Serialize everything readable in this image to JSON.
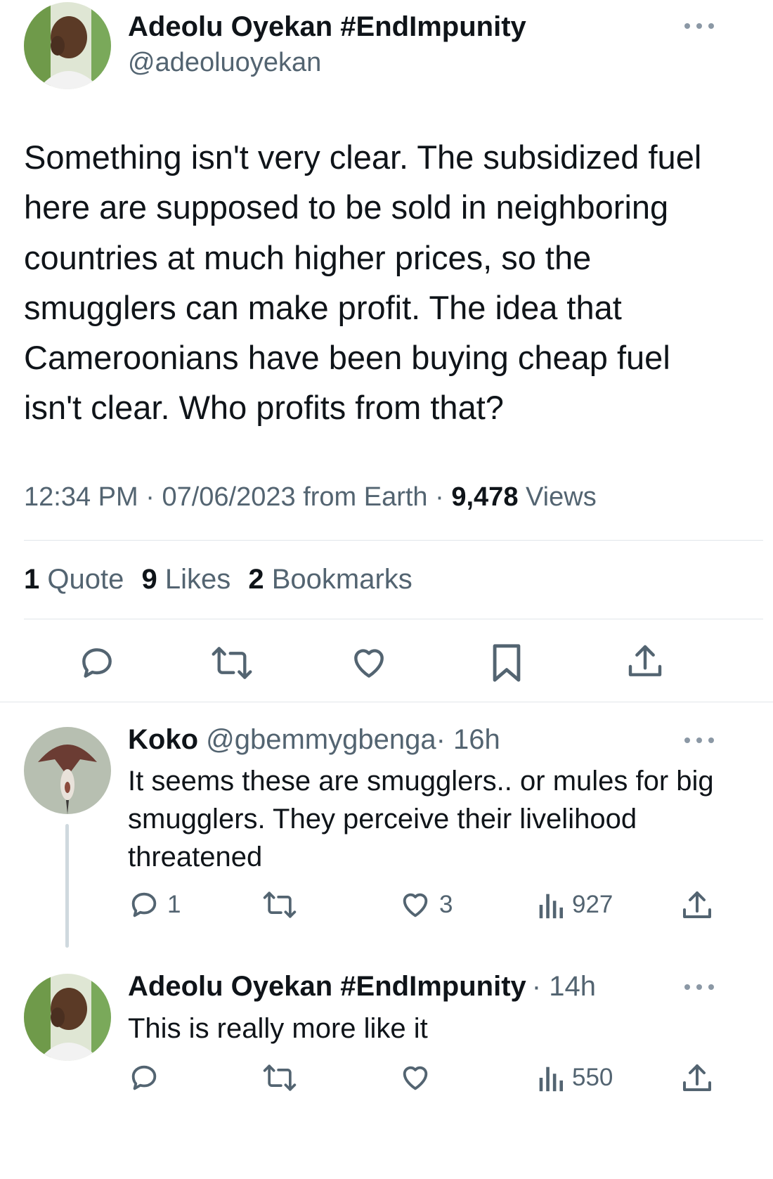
{
  "tweet": {
    "author_name": "Adeolu Oyekan #EndImpunity",
    "author_handle": "@adeoluoyekan",
    "text": "Something isn't very clear. The subsidized fuel here are supposed to be sold in neighboring countries at much higher prices, so the smugglers can make profit. The idea that Cameroonians have been buying cheap fuel isn't clear. Who profits from that?",
    "time": "12:34 PM",
    "dot1": "·",
    "date": "07/06/2023",
    "source": "from Earth",
    "dot2": "·",
    "views_count": "9,478",
    "views_label": "Views",
    "stats": {
      "quotes_count": "1",
      "quotes_label": "Quote",
      "likes_count": "9",
      "likes_label": "Likes",
      "bookmarks_count": "2",
      "bookmarks_label": "Bookmarks"
    },
    "actions": [
      "reply-icon",
      "retweet-icon",
      "like-icon",
      "bookmark-icon",
      "share-icon"
    ]
  },
  "replies": [
    {
      "name": "Koko",
      "handle": "@gbemmygbenga",
      "separator": "·",
      "time": "16h",
      "text": "It seems these are smugglers.. or mules for big smugglers. They perceive their livelihood threatened",
      "reply_count": "1",
      "retweet_count": "",
      "like_count": "3",
      "views_count": "927"
    },
    {
      "name": "Adeolu Oyekan #EndImpunity",
      "handle": "",
      "separator": "·",
      "time": "14h",
      "text": "This is really more like it",
      "reply_count": "",
      "retweet_count": "",
      "like_count": "",
      "views_count": "550"
    }
  ],
  "colors": {
    "text": "#0f1419",
    "secondary": "#536471",
    "divider": "#e1e6ea",
    "thread_line": "#cfd9de"
  }
}
